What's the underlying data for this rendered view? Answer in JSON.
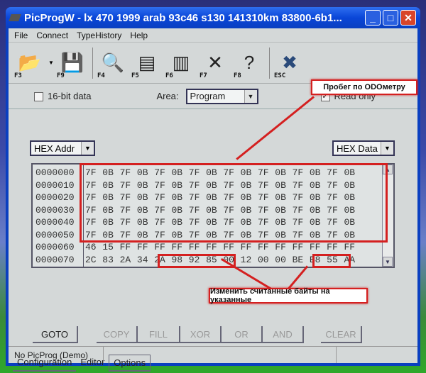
{
  "window": {
    "title": "PicProgW - lx 470 1999 arab 93c46 s130 141310km 83800-6b1...",
    "controls": {
      "minimize": "_",
      "maximize": "□",
      "close": "✕"
    }
  },
  "menu": [
    "File",
    "Connect",
    "TypeHistory",
    "Help"
  ],
  "toolbar": [
    {
      "icon": "open-folder-icon",
      "key": "F3",
      "glyph": "📂"
    },
    {
      "icon": "save-disk-icon",
      "key": "F9",
      "glyph": "💾"
    },
    {
      "icon": "chip-search-icon",
      "key": "F4",
      "glyph": "🔍"
    },
    {
      "icon": "read-chip-icon",
      "key": "F5",
      "glyph": "▤"
    },
    {
      "icon": "write-chip-icon",
      "key": "F6",
      "glyph": "▥"
    },
    {
      "icon": "erase-icon",
      "key": "F7",
      "glyph": "✕"
    },
    {
      "icon": "identify-chip-icon",
      "key": "F8",
      "glyph": "?"
    },
    {
      "icon": "cancel-icon",
      "key": "ESC",
      "glyph": "✖"
    }
  ],
  "options": {
    "sixteen_bit_label": "16-bit data",
    "sixteen_bit_checked": false,
    "area_label": "Area:",
    "area_value": "Program",
    "read_only_label": "Read only",
    "read_only_checked": true
  },
  "addr_format": "HEX Addr",
  "data_format": "HEX Data",
  "hex_rows": [
    {
      "addr": "0000000",
      "bytes": [
        "7F",
        "0B",
        "7F",
        "0B",
        "7F",
        "0B",
        "7F",
        "0B",
        "7F",
        "0B",
        "7F",
        "0B",
        "7F",
        "0B",
        "7F",
        "0B"
      ]
    },
    {
      "addr": "0000010",
      "bytes": [
        "7F",
        "0B",
        "7F",
        "0B",
        "7F",
        "0B",
        "7F",
        "0B",
        "7F",
        "0B",
        "7F",
        "0B",
        "7F",
        "0B",
        "7F",
        "0B"
      ]
    },
    {
      "addr": "0000020",
      "bytes": [
        "7F",
        "0B",
        "7F",
        "0B",
        "7F",
        "0B",
        "7F",
        "0B",
        "7F",
        "0B",
        "7F",
        "0B",
        "7F",
        "0B",
        "7F",
        "0B"
      ]
    },
    {
      "addr": "0000030",
      "bytes": [
        "7F",
        "0B",
        "7F",
        "0B",
        "7F",
        "0B",
        "7F",
        "0B",
        "7F",
        "0B",
        "7F",
        "0B",
        "7F",
        "0B",
        "7F",
        "0B"
      ]
    },
    {
      "addr": "0000040",
      "bytes": [
        "7F",
        "0B",
        "7F",
        "0B",
        "7F",
        "0B",
        "7F",
        "0B",
        "7F",
        "0B",
        "7F",
        "0B",
        "7F",
        "0B",
        "7F",
        "0B"
      ]
    },
    {
      "addr": "0000050",
      "bytes": [
        "7F",
        "0B",
        "7F",
        "0B",
        "7F",
        "0B",
        "7F",
        "0B",
        "7F",
        "0B",
        "7F",
        "0B",
        "7F",
        "0B",
        "7F",
        "0B"
      ]
    },
    {
      "addr": "0000060",
      "bytes": [
        "46",
        "15",
        "FF",
        "FF",
        "FF",
        "FF",
        "FF",
        "FF",
        "FF",
        "FF",
        "FF",
        "FF",
        "FF",
        "FF",
        "FF",
        "FF"
      ]
    },
    {
      "addr": "0000070",
      "bytes": [
        "2C",
        "83",
        "2A",
        "34",
        "2A",
        "98",
        "92",
        "85",
        "00",
        "12",
        "00",
        "00",
        "BE",
        "B8",
        "55",
        "AA"
      ]
    }
  ],
  "annotations": {
    "odometer": "Пробег по ODOметру",
    "change_bytes": "Изменить считанные байты на указанные",
    "accent": "#d42020"
  },
  "buttons": [
    {
      "label": "GOTO",
      "enabled": true
    },
    {
      "label": "COPY",
      "enabled": false
    },
    {
      "label": "FILL",
      "enabled": false
    },
    {
      "label": "XOR",
      "enabled": false
    },
    {
      "label": "OR",
      "enabled": false
    },
    {
      "label": "AND",
      "enabled": false
    },
    {
      "label": "CLEAR",
      "enabled": false
    }
  ],
  "tabs": [
    {
      "label": "Configuration",
      "active": false
    },
    {
      "label": "Editor",
      "active": true
    },
    {
      "label": "Options",
      "active": false
    }
  ],
  "status": {
    "left": "No PicProg (Demo)",
    "middle": "",
    "right": ""
  }
}
